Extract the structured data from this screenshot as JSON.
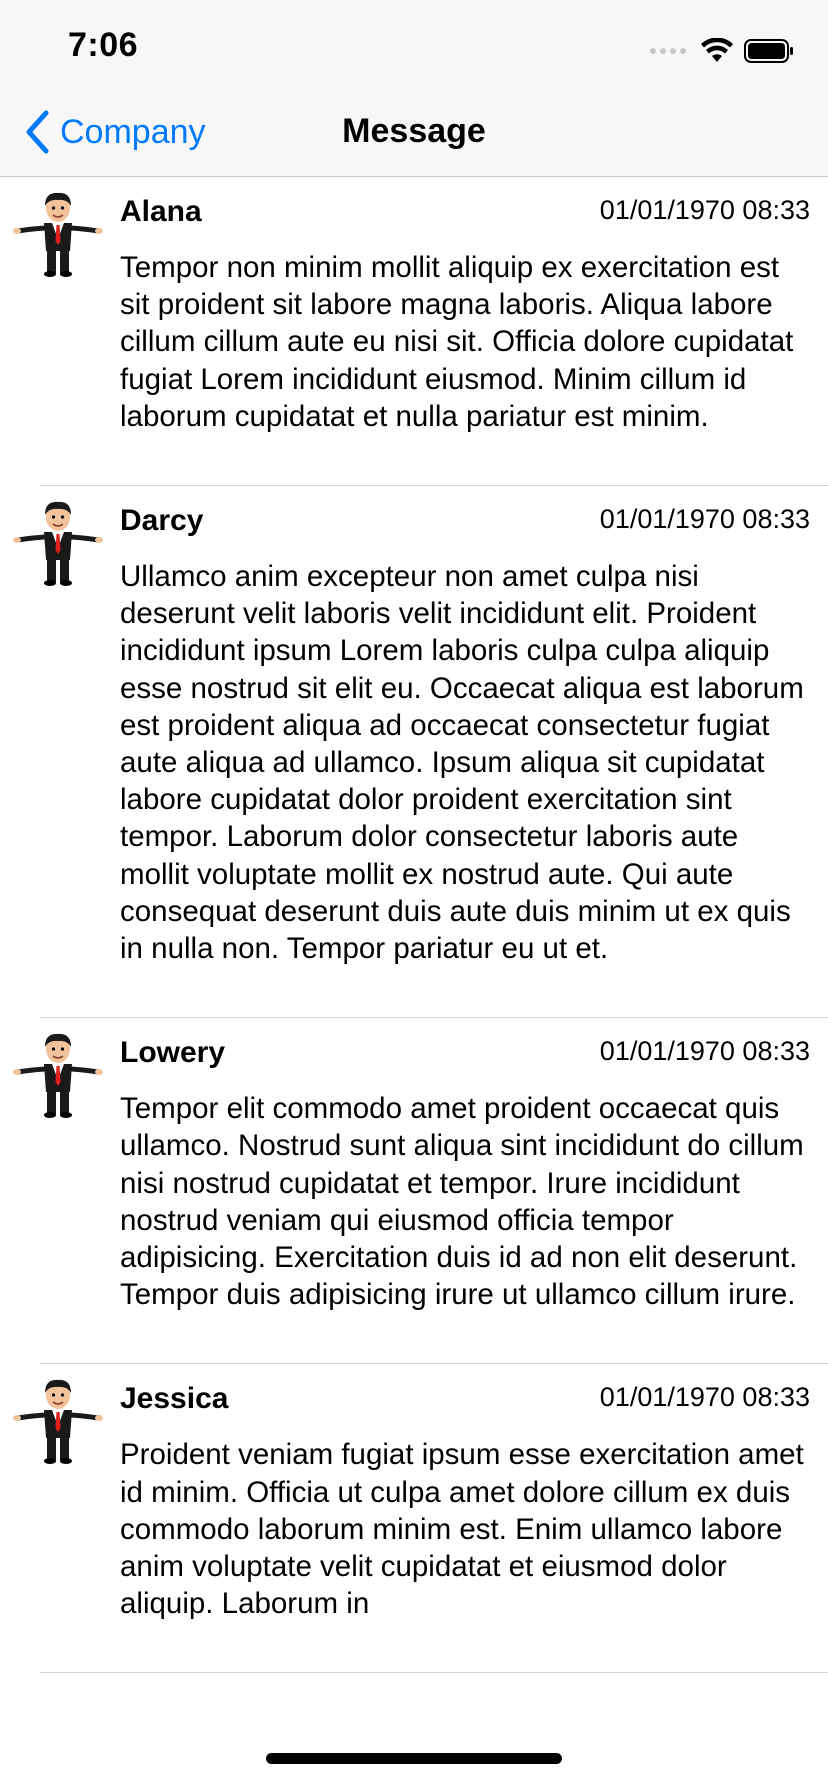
{
  "status": {
    "time": "7:06"
  },
  "nav": {
    "back_label": "Company",
    "title": "Message"
  },
  "messages": [
    {
      "sender": "Alana",
      "timestamp": "01/01/1970 08:33",
      "text": "Tempor non minim mollit aliquip ex exercitation est sit proident sit labore magna laboris. Aliqua labore cillum cillum aute eu nisi sit. Officia dolore cupidatat fugiat Lorem incididunt eiusmod. Minim cillum id laborum cupidatat et nulla pariatur est minim."
    },
    {
      "sender": "Darcy",
      "timestamp": "01/01/1970 08:33",
      "text": "Ullamco anim excepteur non amet culpa nisi deserunt velit laboris velit incididunt elit. Proident incididunt ipsum Lorem laboris culpa culpa aliquip esse nostrud sit elit eu. Occaecat aliqua est laborum est proident aliqua ad occaecat consectetur fugiat aute aliqua ad ullamco. Ipsum aliqua sit cupidatat labore cupidatat dolor proident exercitation sint tempor. Laborum dolor consectetur laboris aute mollit voluptate mollit ex nostrud aute. Qui aute consequat deserunt duis aute duis minim ut ex quis in nulla non. Tempor pariatur eu ut et."
    },
    {
      "sender": "Lowery",
      "timestamp": "01/01/1970 08:33",
      "text": "Tempor elit commodo amet proident occaecat quis ullamco. Nostrud sunt aliqua sint incididunt do cillum nisi nostrud cupidatat et tempor. Irure incididunt nostrud veniam qui eiusmod officia tempor adipisicing. Exercitation duis id ad non elit deserunt. Tempor duis adipisicing irure ut ullamco cillum irure."
    },
    {
      "sender": "Jessica",
      "timestamp": "01/01/1970 08:33",
      "text": "Proident veniam fugiat ipsum esse exercitation amet id minim. Officia ut culpa amet dolore cillum ex duis commodo laborum minim est. Enim ullamco labore anim voluptate velit cupidatat et eiusmod dolor aliquip. Laborum in"
    }
  ],
  "icons": {
    "back": "chevron-left-icon",
    "signal": "cellular-signal-icon",
    "wifi": "wifi-icon",
    "battery": "battery-icon",
    "avatar": "businessman-avatar-icon"
  },
  "colors": {
    "accent": "#007aff",
    "bar_background": "#f7f7f7",
    "separator": "#d6d6d8",
    "tie": "#e0201a"
  }
}
